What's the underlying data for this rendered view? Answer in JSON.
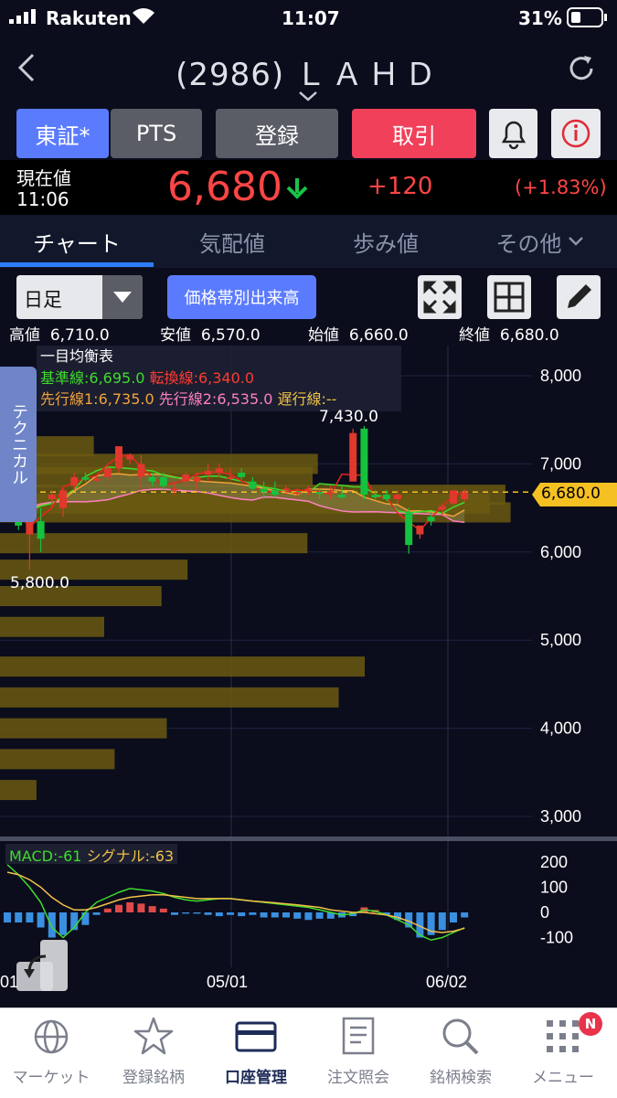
{
  "status": {
    "carrier": "Rakuten",
    "time": "11:07",
    "battery": "31%"
  },
  "header": {
    "code": "(2986)",
    "name": "ＬＡＨＤ"
  },
  "buttons": {
    "market": "東証*",
    "pts": "PTS",
    "register": "登録",
    "trade": "取引"
  },
  "price": {
    "label": "現在値",
    "time": "11:06",
    "value": "6,680",
    "change": "+120",
    "change_pct": "(+1.83%)"
  },
  "tabs": [
    {
      "label": "チャート"
    },
    {
      "label": "気配値"
    },
    {
      "label": "歩み値"
    },
    {
      "label": "その他"
    }
  ],
  "chart_controls": {
    "period": "日足",
    "volume_btn": "価格帯別出来高"
  },
  "ohlc": {
    "high_label": "高値",
    "high": "6,710.0",
    "low_label": "安値",
    "low": "6,570.0",
    "open_label": "始値",
    "open": "6,660.0",
    "close_label": "終値",
    "close": "6,680.0"
  },
  "ichimoku": {
    "title": "一目均衡表",
    "kijun": "基準線:6,695.0",
    "tenkan": "転換線:6,340.0",
    "senko1": "先行線1:6,735.0",
    "senko2": "先行線2:6,535.0",
    "chikou": "遅行線:--"
  },
  "technical_tab": "テクニカル",
  "annotations": {
    "peak": "7,430.0",
    "trough": "5,800.0",
    "current": "6,680.0"
  },
  "macd": {
    "macd": "MACD:-61",
    "signal": "シグナル:-63"
  },
  "colors": {
    "kijun": "#3fdc2c",
    "tenkan": "#e8231f",
    "senko1": "#f2a33a",
    "senko2": "#ff7fc0",
    "up": "#e0382c",
    "down": "#15c13d",
    "volume_bar": "#6b5a12",
    "macd_line": "#3fdc2c",
    "signal_line": "#f2c14a"
  },
  "chart_data": {
    "type": "candlestick",
    "price_ticks": [
      "8,000",
      "7,000",
      "6,000",
      "5,000",
      "4,000",
      "3,000"
    ],
    "ylim": [
      3000,
      8200
    ],
    "date_ticks": [
      "01",
      "05/01",
      "06/02"
    ],
    "macd_ticks": [
      "200",
      "100",
      "0",
      "-100"
    ],
    "candles": [
      {
        "o": 6700,
        "h": 6750,
        "l": 6550,
        "c": 6600
      },
      {
        "o": 6600,
        "h": 6650,
        "l": 6250,
        "c": 6300
      },
      {
        "o": 6200,
        "h": 6400,
        "l": 5800,
        "c": 6400
      },
      {
        "o": 6350,
        "h": 6500,
        "l": 6000,
        "c": 6150
      },
      {
        "o": 6600,
        "h": 6700,
        "l": 6500,
        "c": 6650
      },
      {
        "o": 6500,
        "h": 6720,
        "l": 6400,
        "c": 6700
      },
      {
        "o": 6750,
        "h": 6900,
        "l": 6700,
        "c": 6850
      },
      {
        "o": 6850,
        "h": 6900,
        "l": 6800,
        "c": 6820
      },
      {
        "o": 6820,
        "h": 6850,
        "l": 6800,
        "c": 6830
      },
      {
        "o": 6850,
        "h": 6980,
        "l": 6800,
        "c": 6950
      },
      {
        "o": 6950,
        "h": 7200,
        "l": 6900,
        "c": 7200
      },
      {
        "o": 7050,
        "h": 7120,
        "l": 7000,
        "c": 7100
      },
      {
        "o": 6850,
        "h": 7100,
        "l": 6700,
        "c": 7000
      },
      {
        "o": 6850,
        "h": 6900,
        "l": 6750,
        "c": 6800
      },
      {
        "o": 6850,
        "h": 6900,
        "l": 6700,
        "c": 6750
      },
      {
        "o": 6720,
        "h": 6800,
        "l": 6650,
        "c": 6720
      },
      {
        "o": 6800,
        "h": 6900,
        "l": 6750,
        "c": 6880
      },
      {
        "o": 6800,
        "h": 6900,
        "l": 6700,
        "c": 6850
      },
      {
        "o": 6880,
        "h": 7000,
        "l": 6800,
        "c": 6920
      },
      {
        "o": 6900,
        "h": 7000,
        "l": 6850,
        "c": 6950
      },
      {
        "o": 6850,
        "h": 6950,
        "l": 6820,
        "c": 6850
      },
      {
        "o": 6900,
        "h": 6950,
        "l": 6820,
        "c": 6850
      },
      {
        "o": 6800,
        "h": 6850,
        "l": 6700,
        "c": 6720
      },
      {
        "o": 6720,
        "h": 6800,
        "l": 6600,
        "c": 6680
      },
      {
        "o": 6700,
        "h": 6800,
        "l": 6620,
        "c": 6650
      },
      {
        "o": 6700,
        "h": 6750,
        "l": 6650,
        "c": 6720
      },
      {
        "o": 6660,
        "h": 6720,
        "l": 6600,
        "c": 6680
      },
      {
        "o": 6700,
        "h": 6750,
        "l": 6650,
        "c": 6720
      },
      {
        "o": 6680,
        "h": 6720,
        "l": 6600,
        "c": 6660
      },
      {
        "o": 6680,
        "h": 6750,
        "l": 6600,
        "c": 6680
      },
      {
        "o": 6650,
        "h": 6750,
        "l": 6600,
        "c": 6620
      },
      {
        "o": 6800,
        "h": 7400,
        "l": 6800,
        "c": 7350
      },
      {
        "o": 7400,
        "h": 7430,
        "l": 6600,
        "c": 6650
      },
      {
        "o": 6650,
        "h": 6700,
        "l": 6600,
        "c": 6620
      },
      {
        "o": 6650,
        "h": 6700,
        "l": 6580,
        "c": 6600
      },
      {
        "o": 6600,
        "h": 6700,
        "l": 6550,
        "c": 6650
      },
      {
        "o": 6450,
        "h": 6500,
        "l": 5980,
        "c": 6080
      },
      {
        "o": 6200,
        "h": 6300,
        "l": 6150,
        "c": 6300
      },
      {
        "o": 6400,
        "h": 6450,
        "l": 6300,
        "c": 6350
      },
      {
        "o": 6480,
        "h": 6550,
        "l": 6400,
        "c": 6520
      },
      {
        "o": 6550,
        "h": 6700,
        "l": 6530,
        "c": 6700
      },
      {
        "o": 6600,
        "h": 6710,
        "l": 6570,
        "c": 6680
      }
    ],
    "volume_profile": [
      {
        "price": 7200,
        "len": 0.18
      },
      {
        "price": 7000,
        "len": 0.61
      },
      {
        "price": 6850,
        "len": 0.6
      },
      {
        "price": 6650,
        "len": 0.97
      },
      {
        "price": 6550,
        "len": 0.94
      },
      {
        "price": 6450,
        "len": 0.98
      },
      {
        "price": 6100,
        "len": 0.59
      },
      {
        "price": 5800,
        "len": 0.36
      },
      {
        "price": 5500,
        "len": 0.31
      },
      {
        "price": 5150,
        "len": 0.2
      },
      {
        "price": 4700,
        "len": 0.7
      },
      {
        "price": 4350,
        "len": 0.65
      },
      {
        "price": 4000,
        "len": 0.32
      },
      {
        "price": 3650,
        "len": 0.22
      },
      {
        "price": 3300,
        "len": 0.07
      }
    ],
    "macd_hist": [
      -40,
      -40,
      -40,
      -60,
      -100,
      -90,
      -70,
      -50,
      -10,
      15,
      30,
      40,
      35,
      25,
      15,
      -10,
      -5,
      -5,
      -10,
      -15,
      -10,
      -15,
      -10,
      -20,
      -20,
      -20,
      -25,
      -30,
      -25,
      -25,
      -20,
      -15,
      20,
      10,
      -10,
      -30,
      -60,
      -100,
      -90,
      -70,
      -40,
      -20
    ],
    "macd_line": [
      190,
      150,
      100,
      40,
      -60,
      -100,
      -60,
      0,
      40,
      60,
      80,
      95,
      90,
      85,
      75,
      60,
      50,
      45,
      50,
      55,
      55,
      50,
      45,
      40,
      35,
      30,
      25,
      20,
      10,
      0,
      -10,
      -5,
      10,
      5,
      -10,
      -30,
      -50,
      -90,
      -110,
      -100,
      -80,
      -61
    ],
    "signal_line": [
      160,
      150,
      130,
      100,
      60,
      30,
      10,
      10,
      20,
      35,
      50,
      60,
      65,
      70,
      70,
      65,
      60,
      55,
      55,
      55,
      55,
      50,
      45,
      42,
      38,
      34,
      30,
      25,
      20,
      10,
      5,
      0,
      0,
      -5,
      -10,
      -20,
      -35,
      -55,
      -75,
      -80,
      -75,
      -63
    ]
  },
  "nav": [
    {
      "label": "マーケット"
    },
    {
      "label": "登録銘柄"
    },
    {
      "label": "口座管理"
    },
    {
      "label": "注文照会"
    },
    {
      "label": "銘柄検索"
    },
    {
      "label": "メニュー"
    }
  ],
  "nav_badge": "N"
}
